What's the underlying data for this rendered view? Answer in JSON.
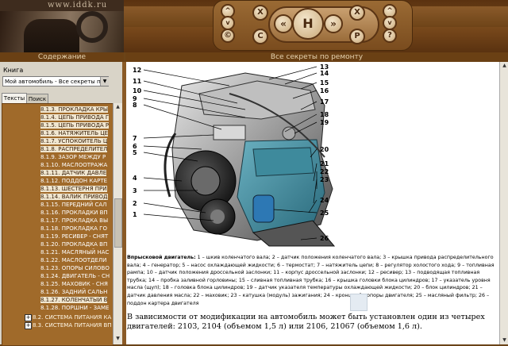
{
  "header": {
    "site_url": "www.iddk.ru",
    "nav_buttons": {
      "up": "^",
      "down": "v",
      "close_left": "X",
      "close_right": "X",
      "back": "«",
      "forward": "»",
      "home": "H",
      "copyright": "©",
      "print": "P",
      "help": "?"
    }
  },
  "left_panel": {
    "title": "Содержание",
    "book_label": "Книга",
    "book_select_value": "Мой автомобиль - Все секреты по ре",
    "tabs": [
      "Тексты",
      "Поиск"
    ],
    "tree": [
      {
        "label": "8.1.3. ПРОКЛАДКА КРЫ",
        "hl": true
      },
      {
        "label": "8.1.4. ЦЕПЬ ПРИВОДА Г",
        "hl": true
      },
      {
        "label": "8.1.5. ЦЕПЬ ПРИВОДА Р",
        "hl": true
      },
      {
        "label": "8.1.6. НАТЯЖИТЕЛЬ ЦЕ",
        "hl": true
      },
      {
        "label": "8.1.7. УСПОКОИТЕЛЬ Ц",
        "hl": true
      },
      {
        "label": "8.1.8. РАСПРЕДЕЛИТЕЛ",
        "hl": true
      },
      {
        "label": "8.1.9. ЗАЗОР МЕЖДУ Р",
        "hl": false
      },
      {
        "label": "8.1.10. МАСЛООТРАЖА",
        "hl": false
      },
      {
        "label": "8.1.11. ДАТЧИК ДАВЛЕ",
        "hl": true
      },
      {
        "label": "8.1.12. ПОДДОН КАРТЕ",
        "hl": false
      },
      {
        "label": "8.1.13. ШЕСТЕРНЯ ПРИ",
        "hl": true
      },
      {
        "label": "8.1.14. ВАЛИК ПРИВОД",
        "hl": true
      },
      {
        "label": "8.1.15. ПЕРЕДНИЙ САЛ",
        "hl": false
      },
      {
        "label": "8.1.16. ПРОКЛАДКИ ВП",
        "hl": false
      },
      {
        "label": "8.1.17. ПРОКЛАДКА ВЫ",
        "hl": false
      },
      {
        "label": "8.1.18. ПРОКЛАДКА ГО",
        "hl": false
      },
      {
        "label": "8.1.19. РЕСИВЕР - СНЯТ",
        "hl": false
      },
      {
        "label": "8.1.20. ПРОКЛАДКА ВП",
        "hl": false
      },
      {
        "label": "8.1.21. МАСЛЯНЫЙ НАС",
        "hl": false
      },
      {
        "label": "8.1.22. МАСЛООТДЕЛИ",
        "hl": false
      },
      {
        "label": "8.1.23. ОПОРЫ СИЛОВО",
        "hl": false
      },
      {
        "label": "8.1.24. ДВИГАТЕЛЬ - СН",
        "hl": false
      },
      {
        "label": "8.1.25. МАХОВИК - СНЯ",
        "hl": false
      },
      {
        "label": "8.1.26. ЗАДНИЙ САЛЬН",
        "hl": false
      },
      {
        "label": "8.1.27. КОЛЕНЧАТЫЙ В",
        "hl": true
      },
      {
        "label": "8.1.28. ПОРШНИ - ЗАМЕ",
        "hl": false
      }
    ],
    "subsections": [
      {
        "label": "8.2. СИСТЕМА ПИТАНИЯ КА"
      },
      {
        "label": "8.3. СИСТЕМА ПИТАНИЯ ВП"
      }
    ]
  },
  "right_panel": {
    "title": "Все секреты по ремонту",
    "figure": {
      "callouts_left": [
        "12",
        "11",
        "10",
        "9",
        "8",
        "7",
        "6",
        "5",
        "4",
        "3",
        "2",
        "1"
      ],
      "callouts_right": [
        "13",
        "14",
        "15",
        "16",
        "17",
        "18",
        "19",
        "20",
        "21",
        "22",
        "23",
        "24",
        "25",
        "26"
      ]
    },
    "caption_title": "Впрысковой двигатель:",
    "caption_text": " 1 – шкив коленчатого вала; 2 – датчик положения коленчатого вала; 3 – крышка привода распределительного вала; 4 – генератор; 5 – насос охлаждающей жидкости; 6 – термостат; 7 – натяжитель цепи; 8 – регулятор холостого хода; 9 – топливная рампа; 10 – датчик положения дроссельной заслонки; 11 – корпус дроссельной заслонки; 12 – ресивер; 13 – подводящая топливная трубка; 14 – пробка заливной горловины; 15 – сливная топливная трубка; 16 – крышка головки блока цилиндров; 17 – указатель уровня масла (щуп); 18 – головка блока цилиндров; 19 – датчик указателя температуры охлаждающей жидкости; 20 – блок цилиндров; 21 – датчик давления масла; 22 – маховик; 23 – катушка (модуль) зажигания; 24 – кронштейн опоры двигателя; 25 – масляный фильтр; 26 – поддон картера двигателя",
    "body_text": "В зависимости от модификации на автомобиль может быть установлен один из четырех двигателей: 2103, 2104 (объемом 1,5 л) или 2106, 21067 (объемом 1,6 л)."
  },
  "colors": {
    "frame_brown": "#6b4418",
    "tree_bg": "#a06a2a",
    "button_cream": "#e8d4b0"
  }
}
